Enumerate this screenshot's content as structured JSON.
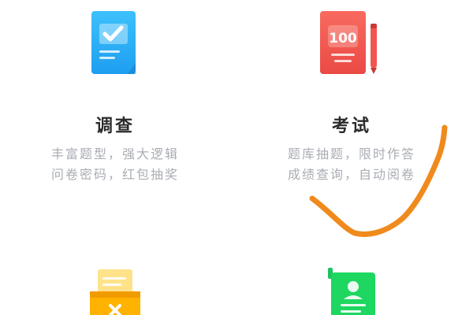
{
  "cards": [
    {
      "title": "调查",
      "desc_line1": "丰富题型，强大逻辑",
      "desc_line2": "问卷密码，红包抽奖",
      "icon": "survey-check-icon",
      "color": "#29b6f6"
    },
    {
      "title": "考试",
      "desc_line1": "题库抽题，限时作答",
      "desc_line2": "成绩查询，自动阅卷",
      "icon": "exam-score-icon",
      "icon_text": "100",
      "color": "#f2544f"
    },
    {
      "title": "",
      "icon": "vote-box-icon",
      "color": "#ffb300"
    },
    {
      "title": "",
      "icon": "form-profile-icon",
      "color": "#1ed760"
    }
  ],
  "annotation": {
    "icon": "handwritten-checkmark",
    "color": "#f08a1c"
  }
}
